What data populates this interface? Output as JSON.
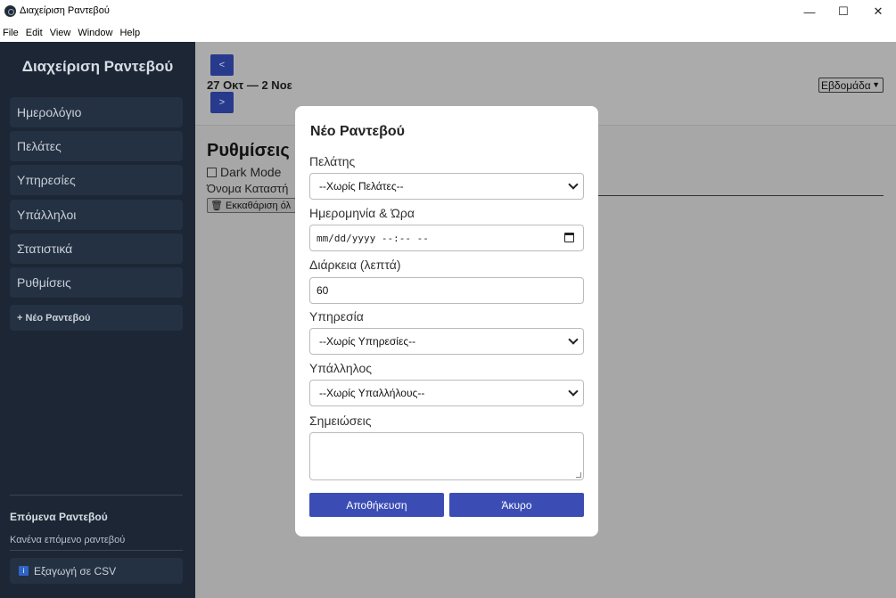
{
  "window": {
    "title": "Διαχείριση Ραντεβού",
    "controls": {
      "minimize": "—",
      "maximize": "☐",
      "close": "✕"
    }
  },
  "menu": [
    "File",
    "Edit",
    "View",
    "Window",
    "Help"
  ],
  "sidebar": {
    "title": "Διαχείριση Ραντεβού",
    "items": [
      {
        "label": "Ημερολόγιο"
      },
      {
        "label": "Πελάτες"
      },
      {
        "label": "Υπηρεσίες"
      },
      {
        "label": "Υπάλληλοι"
      },
      {
        "label": "Στατιστικά"
      },
      {
        "label": "Ρυθμίσεις"
      }
    ],
    "new_appointment": "+ Νέο Ραντεβού",
    "upcoming_title": "Επόμενα Ραντεβού",
    "upcoming_empty": "Κανένα επόμενο ραντεβού",
    "export": {
      "icon": "info-icon",
      "label": "Εξαγωγή σε CSV"
    }
  },
  "calendar_header": {
    "prev": "<",
    "next": ">",
    "range": "27 Οκτ — 2 Νοε",
    "view": "Εβδομάδα"
  },
  "settings": {
    "title": "Ρυθμίσεις",
    "dark_mode": "Dark Mode",
    "store_name": "Όνομα Καταστή",
    "clear_all": "🗑 Εκκαθάριση όλ"
  },
  "modal": {
    "title": "Νέο Ραντεβού",
    "client_label": "Πελάτης",
    "client_value": "--Χωρίς Πελάτες--",
    "datetime_label": "Ημερομηνία & Ώρα",
    "datetime_placeholder": "mm/dd/yyyy --:-- --",
    "duration_label": "Διάρκεια (λεπτά)",
    "duration_value": "60",
    "service_label": "Υπηρεσία",
    "service_value": "--Χωρίς Υπηρεσίες--",
    "employee_label": "Υπάλληλος",
    "employee_value": "--Χωρίς Υπαλλήλους--",
    "notes_label": "Σημειώσεις",
    "save": "Αποθήκευση",
    "cancel": "Άκυρο"
  }
}
